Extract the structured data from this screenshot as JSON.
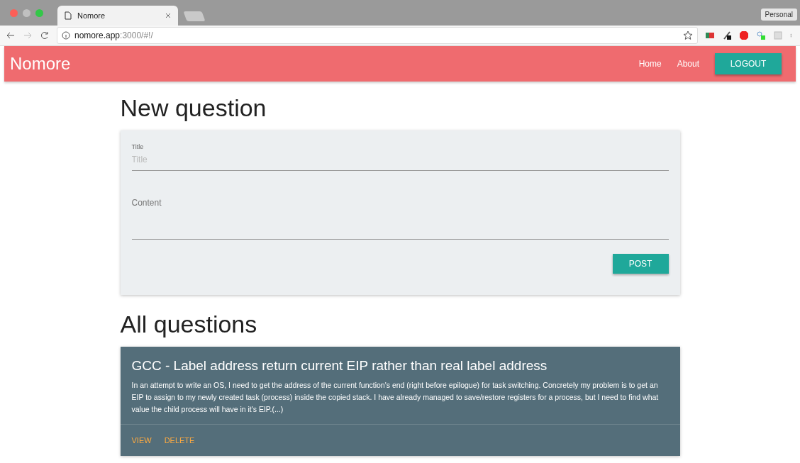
{
  "browser": {
    "tab_title": "Nomore",
    "profile": "Personal",
    "url_host": "nomore.app",
    "url_rest": ":3000/#!/"
  },
  "navbar": {
    "brand": "Nomore",
    "links": [
      "Home",
      "About"
    ],
    "logout": "LOGOUT"
  },
  "new_question": {
    "heading": "New question",
    "title_label": "Title",
    "title_placeholder": "Title",
    "content_label": "Content",
    "post": "POST"
  },
  "all_questions": {
    "heading": "All questions",
    "items": [
      {
        "title": "GCC - Label address return current EIP rather than real label address",
        "body": "In an attempt to write an OS, I need to get the address of the current function's end (right before epilogue) for task switching. Concretely my problem is to get an EIP to assign to my newly created task (process) inside the copied stack. I have already managed to save/restore registers for a process, but I need to find what value the child process will have in it's EIP.(...)",
        "actions": [
          "VIEW",
          "DELETE"
        ]
      }
    ]
  }
}
